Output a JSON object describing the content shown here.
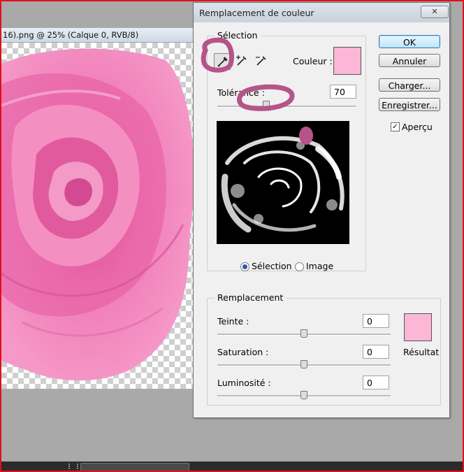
{
  "document": {
    "title": "16).png @ 25% (Calque 0, RVB/8)"
  },
  "dialog": {
    "title": "Remplacement de couleur",
    "close": "✕",
    "selection_group": {
      "legend": "Sélection",
      "color_label": "Couleur :",
      "color": "#fcb6d6",
      "tolerance_label": "Tolérance :",
      "tolerance_value": "70",
      "tolerance_level": 0.35,
      "radio_selection": "Sélection",
      "radio_image": "Image",
      "selected_radio": "Sélection"
    },
    "replacement_group": {
      "legend": "Remplacement",
      "hue_label": "Teinte :",
      "hue_value": "0",
      "saturation_label": "Saturation :",
      "saturation_value": "0",
      "luminosity_label": "Luminosité :",
      "luminosity_value": "0",
      "result_label": "Résultat",
      "result_color": "#fcb6d6"
    },
    "buttons": {
      "ok": "OK",
      "cancel": "Annuler",
      "load": "Charger...",
      "save": "Enregistrer...",
      "preview_label": "Aperçu",
      "preview_checked": true
    }
  }
}
